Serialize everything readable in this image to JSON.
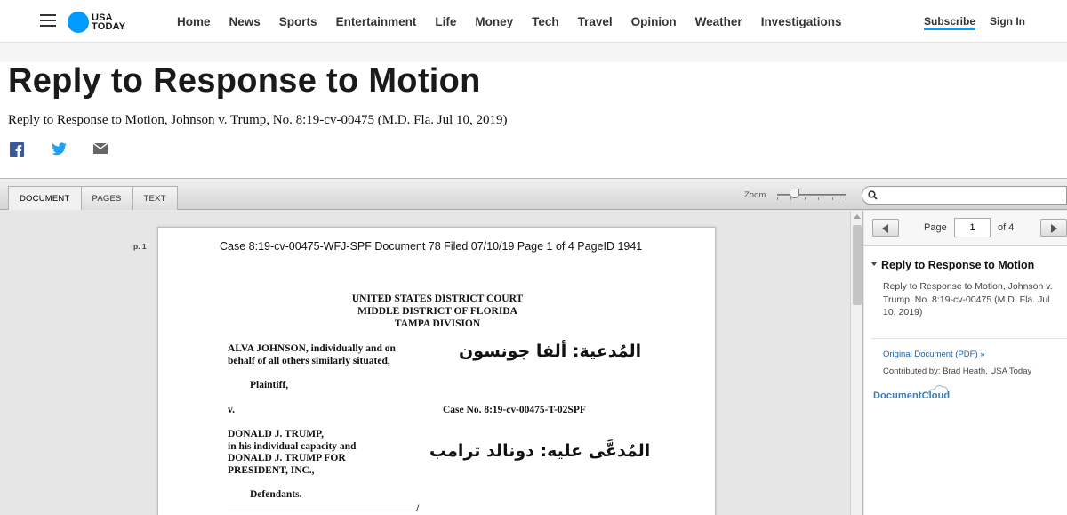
{
  "nav": {
    "logo_line1": "USA",
    "logo_line2": "TODAY",
    "links": [
      "Home",
      "News",
      "Sports",
      "Entertainment",
      "Life",
      "Money",
      "Tech",
      "Travel",
      "Opinion",
      "Weather",
      "Investigations"
    ],
    "subscribe": "Subscribe",
    "signin": "Sign In"
  },
  "header": {
    "title": "Reply to Response to Motion",
    "subtitle": "Reply to Response to Motion, Johnson v. Trump, No. 8:19-cv-00475 (M.D. Fla. Jul 10, 2019)",
    "share_icons": [
      "facebook-icon",
      "twitter-icon",
      "email-icon"
    ]
  },
  "viewer": {
    "tabs": [
      "DOCUMENT",
      "PAGES",
      "TEXT"
    ],
    "active_tab": "DOCUMENT",
    "zoom_label": "Zoom",
    "search_placeholder": "",
    "page_label": "p. 1",
    "document": {
      "case_header": "Case 8:19-cv-00475-WFJ-SPF   Document 78   Filed 07/10/19   Page 1 of 4 PageID 1941",
      "court_lines": [
        "UNITED STATES DISTRICT COURT",
        "MIDDLE DISTRICT OF FLORIDA",
        "TAMPA DIVISION"
      ],
      "plaintiff_lines": [
        "ALVA JOHNSON, individually and on",
        "behalf of all others similarly situated,"
      ],
      "plaintiff_arabic": "المُدعية: ألفا جونسون",
      "plaintiff_label": "Plaintiff,",
      "versus": "v.",
      "case_no": "Case No. 8:19-cv-00475-T-02SPF",
      "defendant_lines": [
        "DONALD J. TRUMP,",
        "in his individual capacity and",
        "DONALD J. TRUMP FOR",
        "PRESIDENT, INC.,"
      ],
      "defendant_arabic": "المُدعَّى عليه: دونالد ترامب",
      "defendant_label": "Defendants.",
      "rule_end": "/"
    },
    "sidebar": {
      "page_label": "Page",
      "current_page": "1",
      "of_label": "of 4",
      "title": "Reply to Response to Motion",
      "description": "Reply to Response to Motion, Johnson v. Trump, No. 8:19-cv-00475 (M.D. Fla. Jul 10, 2019)",
      "original_link": "Original Document (PDF) »",
      "contributed": "Contributed by: Brad Heath, USA Today",
      "brand": "DocumentCloud"
    }
  },
  "colors": {
    "brand_blue": "#009bff",
    "link_blue": "#1d5fa0",
    "documentcloud_blue": "#3a7ab6"
  }
}
